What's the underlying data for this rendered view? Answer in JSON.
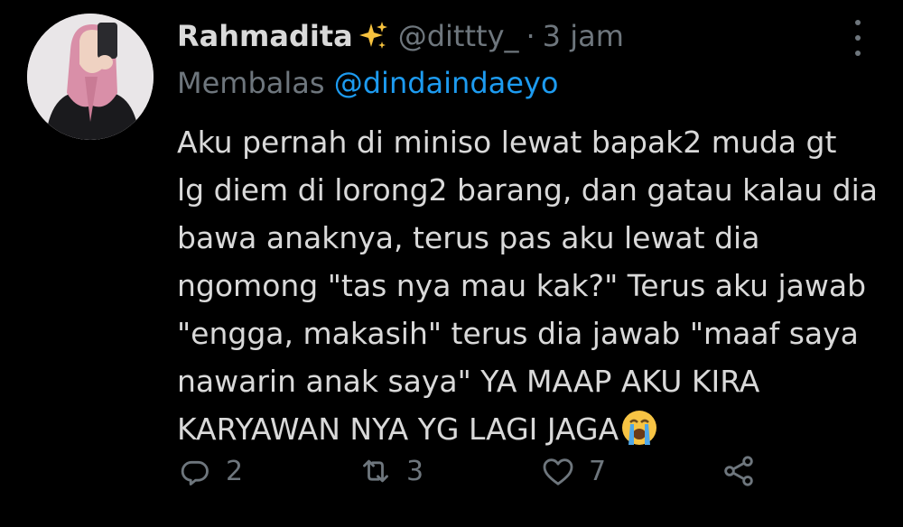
{
  "tweet": {
    "display_name": "Rahmadita",
    "name_emoji": "sparkles",
    "handle": "@dittty_",
    "separator": "·",
    "time": "3 jam",
    "replying_label": "Membalas",
    "replying_to": "@dindaindaeyo",
    "body_lines": [
      "Aku pernah di miniso lewat bapak2 muda gt",
      "lg diem di lorong2 barang, dan gatau kalau dia",
      "bawa anaknya, terus pas aku lewat dia",
      "ngomong \"tas nya mau kak?\" Terus aku jawab",
      "\"engga, makasih\" terus dia jawab \"maaf saya",
      "nawarin anak saya\" YA MAAP AKU KIRA",
      "KARYAWAN NYA YG LAGI JAGA"
    ],
    "trailing_emoji": "loudly-crying-face"
  },
  "actions": {
    "reply_count": "2",
    "retweet_count": "3",
    "like_count": "7"
  },
  "colors": {
    "background": "#000000",
    "text": "#d9d9d9",
    "secondary": "#6e767d",
    "link": "#1d9bf0"
  }
}
